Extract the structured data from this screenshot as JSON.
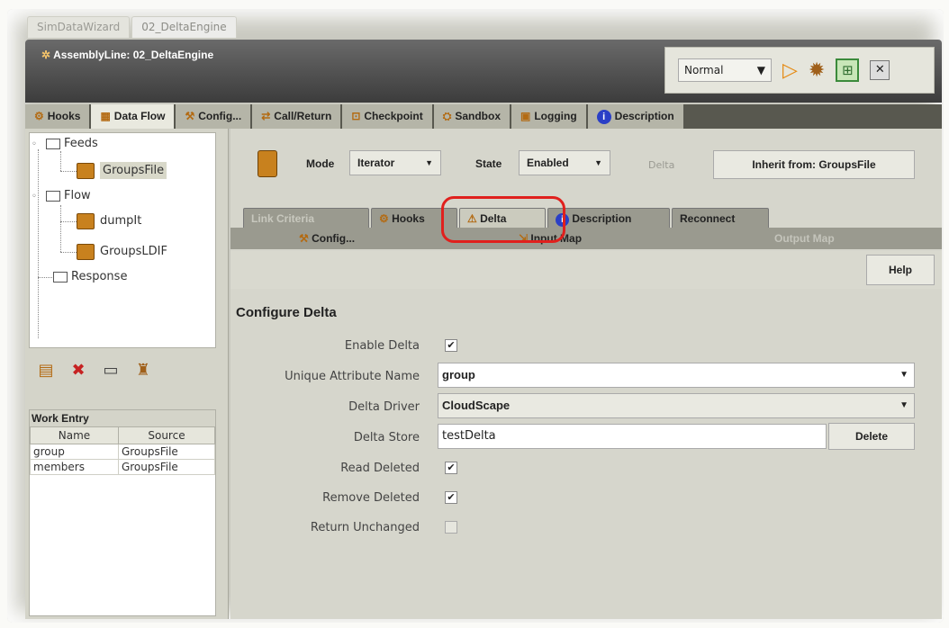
{
  "editor_tabs": [
    {
      "label": "SimDataWizard"
    },
    {
      "label": "02_DeltaEngine"
    }
  ],
  "window": {
    "title": "AssemblyLine: 02_DeltaEngine",
    "run_mode": "Normal"
  },
  "main_tabs": [
    {
      "label": "Hooks"
    },
    {
      "label": "Data Flow"
    },
    {
      "label": "Config..."
    },
    {
      "label": "Call/Return"
    },
    {
      "label": "Checkpoint"
    },
    {
      "label": "Sandbox"
    },
    {
      "label": "Logging"
    },
    {
      "label": "Description"
    }
  ],
  "tree": {
    "feeds": "Feeds",
    "groups_file": "GroupsFile",
    "flow": "Flow",
    "dumpit": "dumpIt",
    "groups_ldif": "GroupsLDIF",
    "response": "Response"
  },
  "work_entry": {
    "title": "Work Entry",
    "headers": [
      "Name",
      "Source"
    ],
    "rows": [
      [
        "group",
        "GroupsFile"
      ],
      [
        "members",
        "GroupsFile"
      ]
    ]
  },
  "component": {
    "mode_label": "Mode",
    "mode_value": "Iterator",
    "state_label": "State",
    "state_value": "Enabled",
    "delta_label": "Delta",
    "inherit_label": "Inherit from: GroupsFile"
  },
  "sub_tabs_row1": [
    {
      "label": "Link Criteria"
    },
    {
      "label": "Hooks"
    },
    {
      "label": "Delta"
    },
    {
      "label": "Description"
    },
    {
      "label": "Reconnect"
    }
  ],
  "sub_tabs_row2": [
    {
      "label": "Config..."
    },
    {
      "label": "Input Map"
    },
    {
      "label": "Output Map"
    }
  ],
  "help_label": "Help",
  "configure_delta": {
    "title": "Configure Delta",
    "enable_delta": {
      "label": "Enable Delta",
      "checked": true
    },
    "unique_attribute": {
      "label": "Unique Attribute Name",
      "value": "group"
    },
    "delta_driver": {
      "label": "Delta Driver",
      "value": "CloudScape"
    },
    "delta_store": {
      "label": "Delta Store",
      "value": "testDelta",
      "button": "Delete"
    },
    "read_deleted": {
      "label": "Read Deleted",
      "checked": true
    },
    "remove_deleted": {
      "label": "Remove Deleted",
      "checked": true
    },
    "return_unchanged": {
      "label": "Return Unchanged",
      "checked": false
    }
  },
  "colors": {
    "highlight_ring": "#e0201d",
    "accent_orange": "#c8811e",
    "info_blue": "#2a3fc6"
  }
}
